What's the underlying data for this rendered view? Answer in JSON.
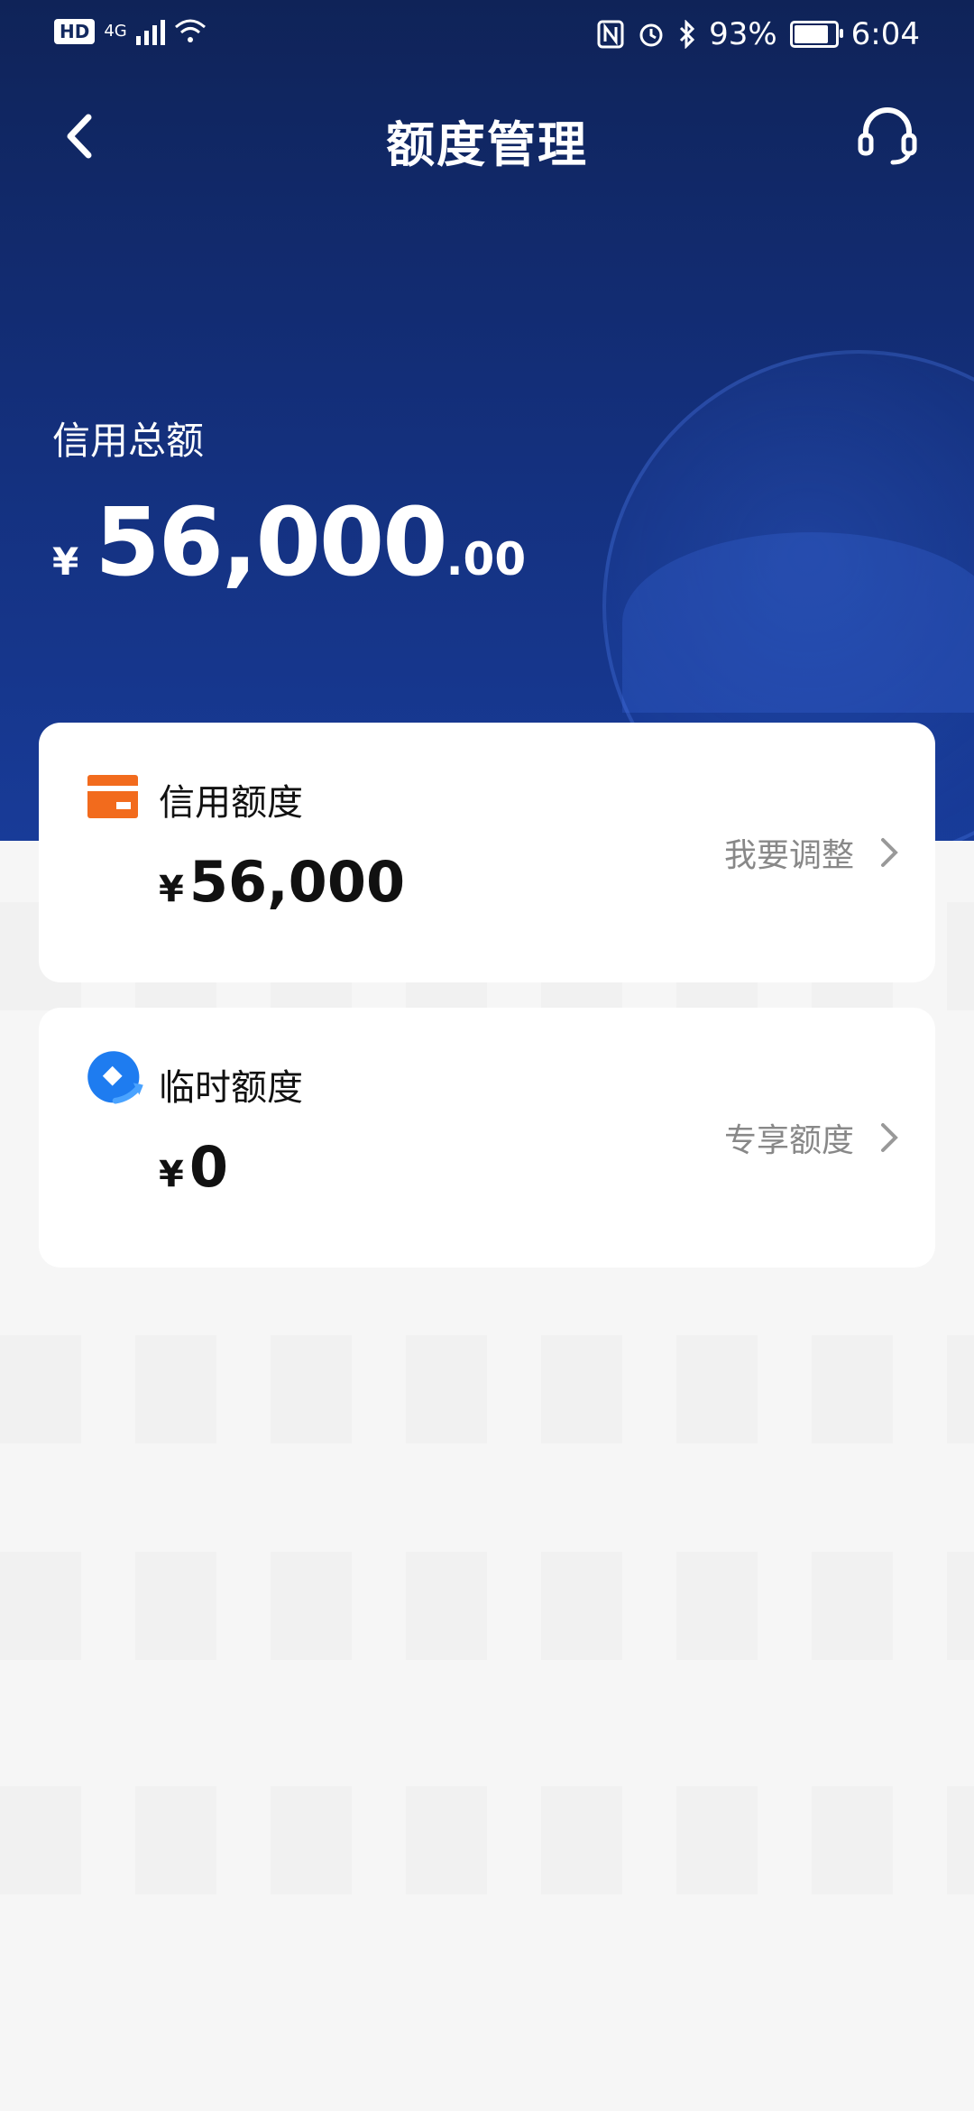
{
  "status_bar": {
    "hd": "HD",
    "network": "4G",
    "battery": "93%",
    "battery_level": 0.93,
    "time": "6:04"
  },
  "header": {
    "title": "额度管理",
    "back_icon": "chevron-left-icon",
    "support_icon": "headset-icon"
  },
  "summary": {
    "label": "信用总额",
    "currency": "¥",
    "amount_int": "56,000",
    "amount_dec": ".00"
  },
  "cards": [
    {
      "title": "信用额度",
      "currency": "¥",
      "amount": "56,000",
      "action": "我要调整",
      "icon": "credit-card-icon",
      "icon_color": "#f26b1d"
    },
    {
      "title": "临时额度",
      "currency": "¥",
      "amount": "0",
      "action": "专享额度",
      "icon": "temporary-limit-icon",
      "icon_color": "#1e7cf0"
    }
  ],
  "colors": {
    "hero_top": "#0f2358",
    "hero_bottom": "#183b98",
    "page_bg": "#f6f6f6"
  }
}
